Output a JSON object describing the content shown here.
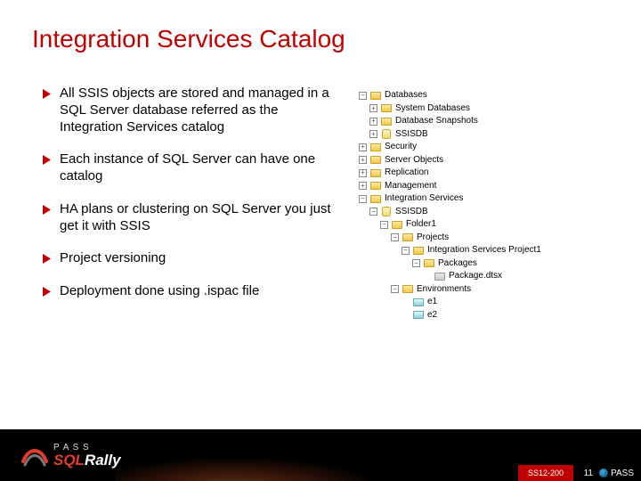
{
  "title": "Integration Services Catalog",
  "bullets": [
    "All SSIS objects are stored and managed in a SQL Server database referred as the Integration Services catalog",
    "Each instance of SQL Server can have one catalog",
    "HA plans or clustering on SQL Server you just get it with SSIS",
    "Project versioning",
    "Deployment done using .ispac file"
  ],
  "tree": {
    "n0": "Databases",
    "n1": "System Databases",
    "n2": "Database Snapshots",
    "n3": "SSISDB",
    "n4": "Security",
    "n5": "Server Objects",
    "n6": "Replication",
    "n7": "Management",
    "n8": "Integration Services",
    "n9": "SSISDB",
    "n10": "Folder1",
    "n11": "Projects",
    "n12": "Integration Services Project1",
    "n13": "Packages",
    "n14": "Package.dtsx",
    "n15": "Environments",
    "n16": "e1",
    "n17": "e2"
  },
  "footer": {
    "pass_small": "P A S S",
    "brand_a": "SQL",
    "brand_b": "Rally",
    "session": "SS12-200",
    "page": "11",
    "org": "PASS"
  }
}
